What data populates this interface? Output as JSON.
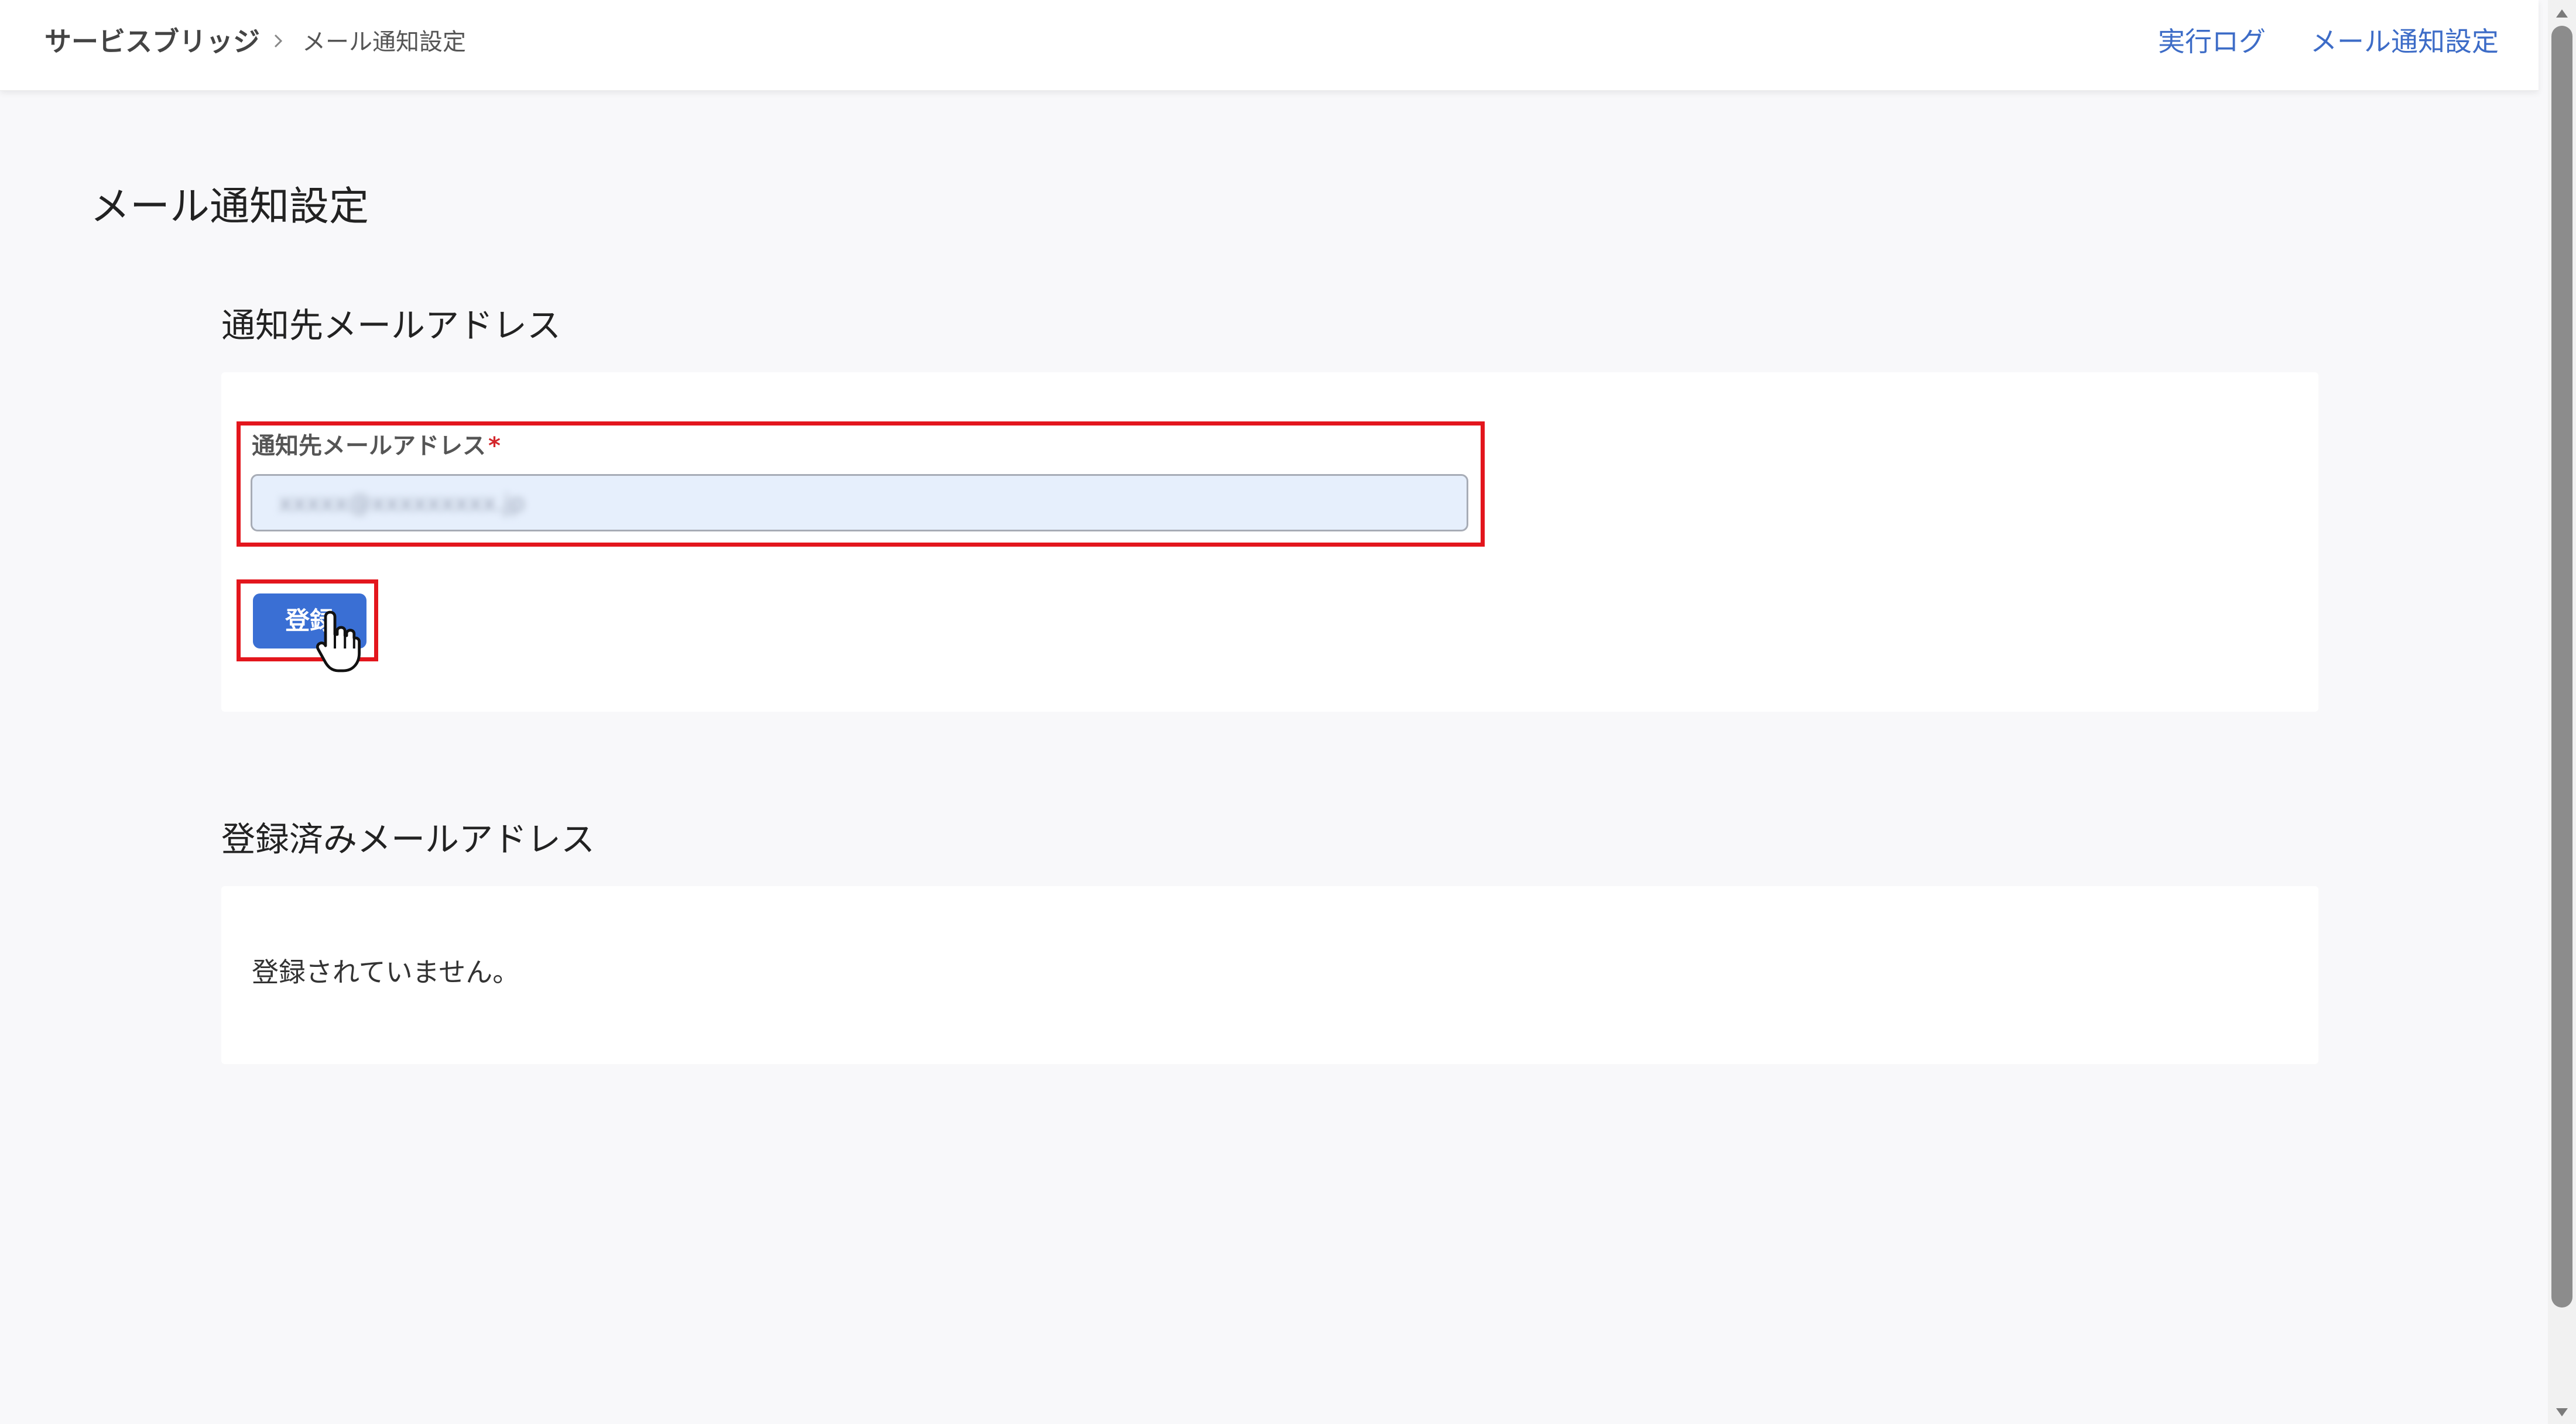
{
  "header": {
    "breadcrumb_root": "サービスブリッジ",
    "breadcrumb_current": "メール通知設定",
    "nav": {
      "execution_log": "実行ログ",
      "mail_settings": "メール通知設定"
    }
  },
  "main": {
    "page_title": "メール通知設定",
    "notification_section": {
      "title": "通知先メールアドレス",
      "field_label": "通知先メールアドレス",
      "required_mark": "*",
      "input_value": "xxxxx@xxxxxxxxx.jp",
      "register_button": "登録"
    },
    "registered_section": {
      "title": "登録済みメールアドレス",
      "empty_message": "登録されていません。"
    }
  },
  "colors": {
    "accent": "#3a6fd4",
    "link": "#3d6cc7",
    "highlight": "#e3161d",
    "input_background": "#e6effc",
    "page_background": "#f8f8fa"
  }
}
